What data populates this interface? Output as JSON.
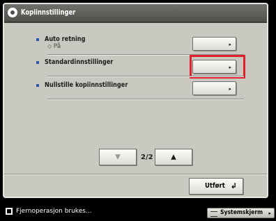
{
  "window": {
    "title": "Kopiinnstillinger"
  },
  "settings": {
    "items": [
      {
        "label": "Auto retning",
        "value": "På",
        "button_arrow": "▸"
      },
      {
        "label": "Standardinnstillinger",
        "button_arrow": "▸"
      },
      {
        "label": "Nullstille kopiinnstillinger",
        "button_arrow": "▸"
      }
    ]
  },
  "pager": {
    "indicator": "2/2",
    "prev_glyph": "▼",
    "next_glyph": "▲"
  },
  "footer": {
    "done_label": "Utført",
    "done_glyph": "↲"
  },
  "status_bar": {
    "message": "Fjernoperasjon brukes...",
    "system_button": "Systemskjerm",
    "system_button_arrow": "▸"
  },
  "highlight": {
    "target": "Standardinnstillinger",
    "color": "#e0202a"
  },
  "colors": {
    "panel": "#c9c9c2",
    "titlebar": "#50504c",
    "bullet": "#2e5aa8"
  }
}
